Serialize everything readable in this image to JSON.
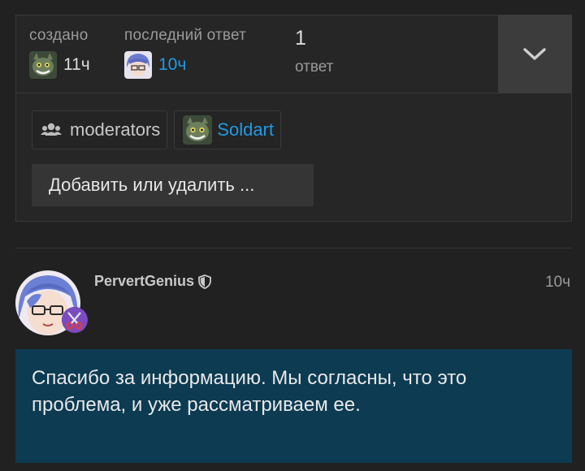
{
  "topic_map": {
    "created": {
      "label": "создано",
      "time": "11ч",
      "avatar_icon": "cat-avatar"
    },
    "last_reply": {
      "label": "последний ответ",
      "time": "10ч",
      "avatar_icon": "anime-avatar"
    },
    "replies": {
      "count": "1",
      "label": "ответ"
    },
    "expand_icon": "chevron-down-icon"
  },
  "participants": {
    "group": {
      "icon": "users-icon",
      "label": "moderators"
    },
    "user": {
      "icon": "cat-avatar",
      "label": "Soldart"
    }
  },
  "add_remove_button": "Добавить или удалить ...",
  "post": {
    "username": "PervertGenius",
    "badge_icon": "shield-icon",
    "date": "10ч",
    "body": "Спасибо за информацию. Мы согласны, что это проблема, и уже рассматриваем ее."
  },
  "colors": {
    "background": "#212121",
    "link": "#1e9be6",
    "post_highlight": "#0c3b52"
  }
}
